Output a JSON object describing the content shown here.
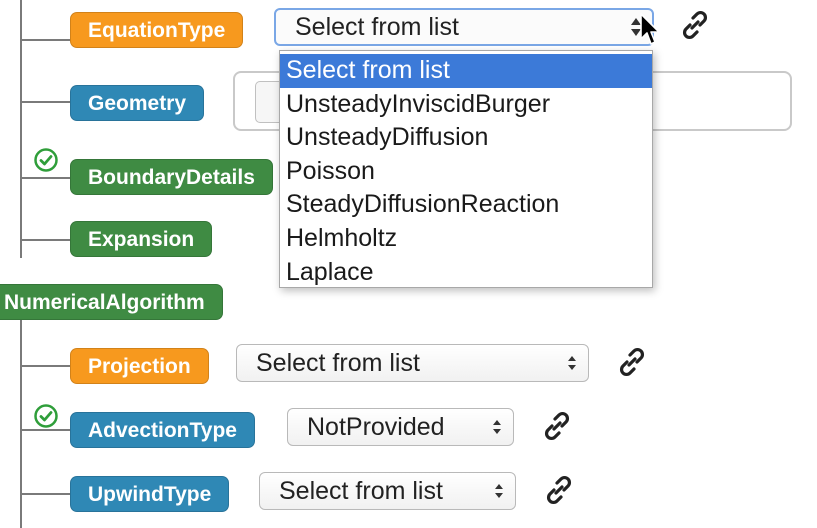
{
  "tree": {
    "equation_type": {
      "label": "EquationType",
      "select_value": "Select from list"
    },
    "geometry": {
      "label": "Geometry"
    },
    "boundary_details": {
      "label": "BoundaryDetails"
    },
    "expansion": {
      "label": "Expansion"
    },
    "numerical_algorithm": {
      "label": "NumericalAlgorithm"
    },
    "projection": {
      "label": "Projection",
      "select_value": "Select from list"
    },
    "advection_type": {
      "label": "AdvectionType",
      "select_value": "NotProvided"
    },
    "upwind_type": {
      "label": "UpwindType",
      "select_value": "Select from list"
    }
  },
  "dropdown": {
    "selected_index": 0,
    "options": [
      "Select from list",
      "UnsteadyInviscidBurger",
      "UnsteadyDiffusion",
      "Poisson",
      "SteadyDiffusionReaction",
      "Helmholtz",
      "Laplace"
    ]
  },
  "colors": {
    "required_badge": "#f7991e",
    "optional_badge": "#2f88b5",
    "group_badge": "#3f8b43",
    "highlight": "#3c7ad8",
    "check": "#2f9e3a"
  },
  "icons": [
    "link-icon",
    "check-circle-icon",
    "select-arrows-icon",
    "mouse-pointer-icon"
  ]
}
